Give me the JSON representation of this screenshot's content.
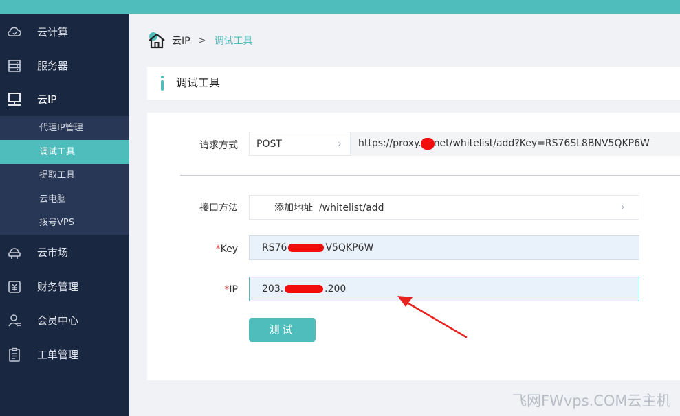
{
  "sidebar": {
    "items": [
      {
        "label": "云计算",
        "icon": "cloud-icon"
      },
      {
        "label": "服务器",
        "icon": "server-icon"
      },
      {
        "label": "云IP",
        "icon": "monitor-icon"
      },
      {
        "label": "云市场",
        "icon": "market-icon"
      },
      {
        "label": "财务管理",
        "icon": "finance-icon"
      },
      {
        "label": "会员中心",
        "icon": "user-icon"
      },
      {
        "label": "工单管理",
        "icon": "ticket-icon"
      }
    ],
    "submenu": [
      {
        "label": "代理IP管理",
        "active": false
      },
      {
        "label": "调试工具",
        "active": true
      },
      {
        "label": "提取工具",
        "active": false
      },
      {
        "label": "云电脑",
        "active": false
      },
      {
        "label": "拨号VPS",
        "active": false
      }
    ]
  },
  "breadcrumb": {
    "root": "云IP",
    "separator": ">",
    "current": "调试工具"
  },
  "panel_title": "调试工具",
  "form": {
    "method_label": "请求方式",
    "method_value": "POST",
    "url_prefix": "https://proxy.",
    "url_suffix": "net/whitelist/add?Key=RS76SL8BNV5QKP6W",
    "api_label": "接口方法",
    "api_name": "添加地址",
    "api_path": "/whitelist/add",
    "key_required": "*",
    "key_label": "Key",
    "key_prefix": "RS76",
    "key_suffix": "V5QKP6W",
    "ip_required": "*",
    "ip_label": "IP",
    "ip_prefix": "203.",
    "ip_suffix": ".200",
    "test_button": "测试"
  },
  "watermark": "飞网FWvps.COM云主机",
  "colors": {
    "accent": "#4fbdbc",
    "sidebar": "#1a2741",
    "submenu": "#283756",
    "redaction": "#f20d0d"
  }
}
